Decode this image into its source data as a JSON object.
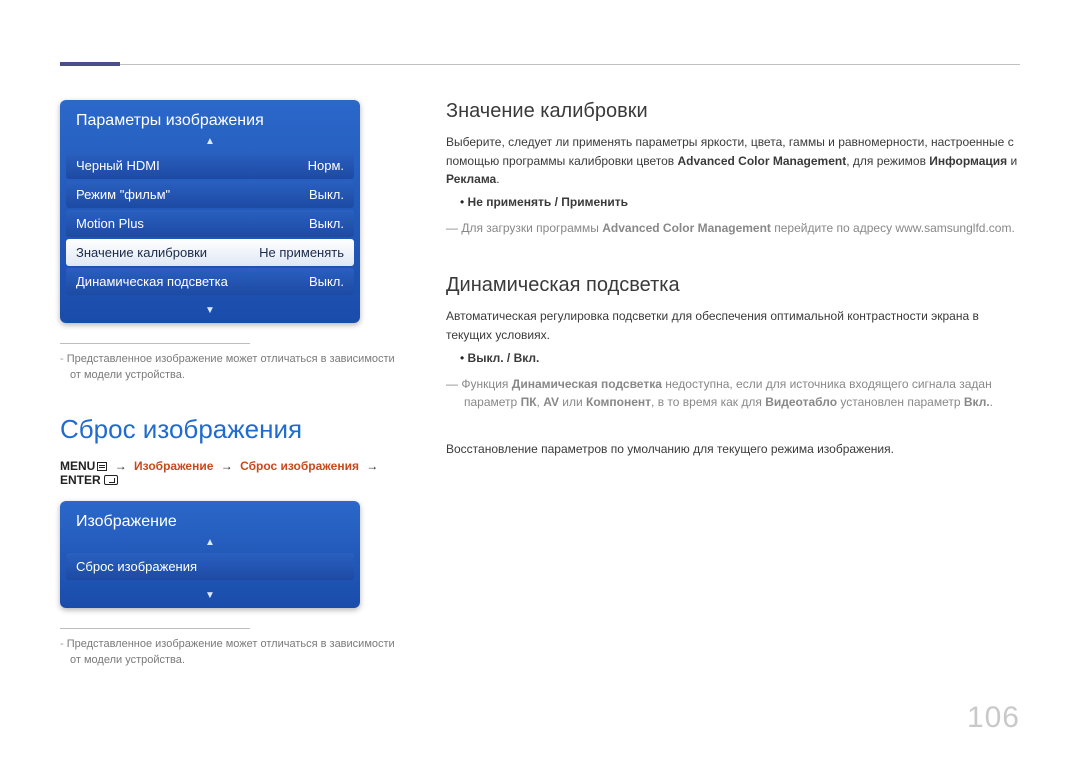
{
  "page_number": "106",
  "left": {
    "osd1": {
      "title": "Параметры изображения",
      "items": [
        {
          "label": "Черный HDMI",
          "value": "Норм.",
          "selected": false
        },
        {
          "label": "Режим \"фильм\"",
          "value": "Выкл.",
          "selected": false
        },
        {
          "label": "Motion Plus",
          "value": "Выкл.",
          "selected": false
        },
        {
          "label": "Значение калибровки",
          "value": "Не применять",
          "selected": true
        },
        {
          "label": "Динамическая подсветка",
          "value": "Выкл.",
          "selected": false
        }
      ]
    },
    "footnote1": "Представленное изображение может отличаться в зависимости от модели устройства.",
    "reset_heading": "Сброс изображения",
    "breadcrumb": {
      "menu": "MENU",
      "step1": "Изображение",
      "step2": "Сброс изображения",
      "enter": "ENTER"
    },
    "osd2": {
      "title": "Изображение",
      "items": [
        {
          "label": "Сброс изображения",
          "value": "",
          "selected": false
        }
      ]
    },
    "footnote2": "Представленное изображение может отличаться в зависимости от модели устройства."
  },
  "right": {
    "calib": {
      "heading": "Значение калибровки",
      "p1a": "Выберите, следует ли применять параметры яркости, цвета, гаммы и равномерности, настроенные с помощью программы калибровки цветов ",
      "p1b": "Advanced Color Management",
      "p1c": ", для режимов ",
      "p1d": "Информация",
      "p1e": " и ",
      "p1f": "Реклама",
      "p1g": ".",
      "bullet": "Не применять / Применить",
      "note_a": "Для загрузки программы ",
      "note_b": "Advanced Color Management",
      "note_c": " перейдите по адресу www.samsunglfd.com."
    },
    "dyn": {
      "heading": "Динамическая подсветка",
      "p1": "Автоматическая регулировка подсветки для обеспечения оптимальной контрастности экрана в текущих условиях.",
      "bullet": "Выкл. / Вкл.",
      "note_a": "Функция ",
      "note_b": "Динамическая подсветка",
      "note_c": " недоступна, если для источника входящего сигнала задан параметр ",
      "note_d": "ПК",
      "note_e": ", ",
      "note_f": "AV",
      "note_g": " или ",
      "note_h": "Компонент",
      "note_i": ", в то время как для ",
      "note_j": "Видеотабло",
      "note_k": " установлен параметр ",
      "note_l": "Вкл.",
      "note_m": "."
    },
    "reset_desc": "Восстановление параметров по умолчанию для текущего режима изображения."
  }
}
